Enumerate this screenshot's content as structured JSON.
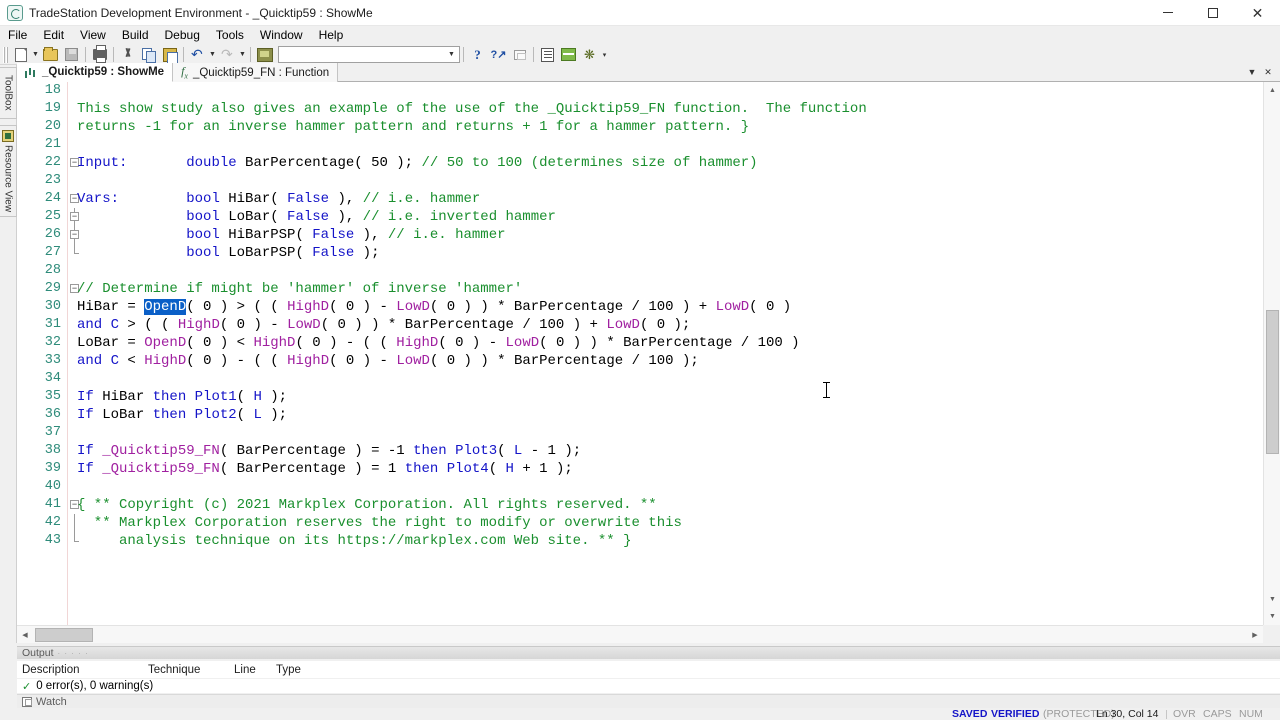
{
  "window": {
    "title": "TradeStation Development Environment - _Quicktip59 : ShowMe",
    "minimize": "–",
    "maximize": "□",
    "close": "✕"
  },
  "menu": {
    "items": [
      "File",
      "Edit",
      "View",
      "Build",
      "Debug",
      "Tools",
      "Window",
      "Help"
    ]
  },
  "toolbar": {
    "combo_value": "",
    "combo_placeholder": "",
    "buttons": [
      {
        "name": "new-document-button",
        "icon": "new-file-icon",
        "label": "New"
      },
      {
        "name": "open-file-button",
        "icon": "open-folder-icon",
        "label": "Open"
      },
      {
        "name": "save-button",
        "icon": "save-disk-icon",
        "label": "Save"
      },
      {
        "name": "print-button",
        "icon": "printer-icon",
        "label": "Print"
      },
      {
        "name": "cut-button",
        "icon": "scissors-icon",
        "label": "Cut"
      },
      {
        "name": "copy-button",
        "icon": "copy-icon",
        "label": "Copy"
      },
      {
        "name": "paste-button",
        "icon": "paste-icon",
        "label": "Paste"
      },
      {
        "name": "undo-button",
        "icon": "undo-arrow-icon",
        "label": "Undo"
      },
      {
        "name": "redo-button",
        "icon": "redo-arrow-icon",
        "label": "Redo"
      },
      {
        "name": "verify-button",
        "icon": "verify-icon",
        "label": "Verify"
      },
      {
        "name": "help-button",
        "icon": "question-mark-icon",
        "label": "Help"
      },
      {
        "name": "context-help-button",
        "icon": "help-pointer-icon",
        "label": "Context Help"
      },
      {
        "name": "bookmark-button",
        "icon": "flag-icon",
        "label": "Bookmark"
      },
      {
        "name": "properties-button",
        "icon": "book-icon",
        "label": "Properties"
      },
      {
        "name": "format-button",
        "icon": "fx-green-icon",
        "label": "Format"
      },
      {
        "name": "favorites-button",
        "icon": "star-icon",
        "label": "Favorites"
      }
    ]
  },
  "left_dock": {
    "toolbox_label": "ToolBox",
    "resource_view_label": "Resource View"
  },
  "tabs": {
    "items": [
      {
        "label": "_Quicktip59 : ShowMe",
        "icon": "showme-icon",
        "active": true
      },
      {
        "label": "_Quicktip59_FN : Function",
        "icon": "function-fx-icon",
        "active": false
      }
    ],
    "dropdown": "▼",
    "close": "✕"
  },
  "editor": {
    "selection_text": "OpenD",
    "lines": [
      {
        "n": "18",
        "fold": "",
        "tokens": []
      },
      {
        "n": "19",
        "fold": "",
        "tokens": [
          {
            "t": "This show study also gives an example of the use of the _Quicktip59_FN function.  The function",
            "c": "c-cmt"
          }
        ]
      },
      {
        "n": "20",
        "fold": "",
        "tokens": [
          {
            "t": "returns -1 for an inverse hammer pattern and returns + 1 for a hammer pattern. }",
            "c": "c-cmt"
          }
        ]
      },
      {
        "n": "21",
        "fold": "",
        "tokens": []
      },
      {
        "n": "22",
        "fold": "minus",
        "tokens": [
          {
            "t": "Input:",
            "c": "c-kw"
          },
          {
            "t": "       ",
            "c": "c-plain"
          },
          {
            "t": "double",
            "c": "c-kw"
          },
          {
            "t": " BarPercentage( 50 ); ",
            "c": "c-plain"
          },
          {
            "t": "// 50 to 100 (determines size of hammer)",
            "c": "c-cmt"
          }
        ]
      },
      {
        "n": "23",
        "fold": "",
        "tokens": []
      },
      {
        "n": "24",
        "fold": "minus",
        "tokens": [
          {
            "t": "Vars:",
            "c": "c-kw"
          },
          {
            "t": "        ",
            "c": "c-plain"
          },
          {
            "t": "bool",
            "c": "c-kw"
          },
          {
            "t": " HiBar( ",
            "c": "c-plain"
          },
          {
            "t": "False",
            "c": "c-kw"
          },
          {
            "t": " ), ",
            "c": "c-plain"
          },
          {
            "t": "// i.e. hammer",
            "c": "c-cmt"
          }
        ]
      },
      {
        "n": "25",
        "fold": "bar-minus",
        "tokens": [
          {
            "t": "             ",
            "c": "c-plain"
          },
          {
            "t": "bool",
            "c": "c-kw"
          },
          {
            "t": " LoBar( ",
            "c": "c-plain"
          },
          {
            "t": "False",
            "c": "c-kw"
          },
          {
            "t": " ), ",
            "c": "c-plain"
          },
          {
            "t": "// i.e. inverted hammer",
            "c": "c-cmt"
          }
        ]
      },
      {
        "n": "26",
        "fold": "bar-minus",
        "tokens": [
          {
            "t": "             ",
            "c": "c-plain"
          },
          {
            "t": "bool",
            "c": "c-kw"
          },
          {
            "t": " HiBarPSP( ",
            "c": "c-plain"
          },
          {
            "t": "False",
            "c": "c-kw"
          },
          {
            "t": " ), ",
            "c": "c-plain"
          },
          {
            "t": "// i.e. hammer",
            "c": "c-cmt"
          }
        ]
      },
      {
        "n": "27",
        "fold": "end",
        "tokens": [
          {
            "t": "             ",
            "c": "c-plain"
          },
          {
            "t": "bool",
            "c": "c-kw"
          },
          {
            "t": " LoBarPSP( ",
            "c": "c-plain"
          },
          {
            "t": "False",
            "c": "c-kw"
          },
          {
            "t": " );",
            "c": "c-plain"
          }
        ]
      },
      {
        "n": "28",
        "fold": "",
        "tokens": []
      },
      {
        "n": "29",
        "fold": "minus",
        "tokens": [
          {
            "t": "// Determine if might be 'hammer' of inverse 'hammer'",
            "c": "c-cmt"
          }
        ]
      },
      {
        "n": "30",
        "fold": "",
        "tokens": [
          {
            "t": "HiBar = ",
            "c": "c-plain"
          },
          {
            "t": "OpenD",
            "c": "sel"
          },
          {
            "t": "( 0 ) > ( ( ",
            "c": "c-plain"
          },
          {
            "t": "HighD",
            "c": "c-res"
          },
          {
            "t": "( 0 ) - ",
            "c": "c-plain"
          },
          {
            "t": "LowD",
            "c": "c-res"
          },
          {
            "t": "( 0 ) ) * BarPercentage / 100 ) + ",
            "c": "c-plain"
          },
          {
            "t": "LowD",
            "c": "c-res"
          },
          {
            "t": "( 0 )",
            "c": "c-plain"
          }
        ]
      },
      {
        "n": "31",
        "fold": "",
        "tokens": [
          {
            "t": "and",
            "c": "c-kw"
          },
          {
            "t": " ",
            "c": "c-plain"
          },
          {
            "t": "C",
            "c": "c-kw"
          },
          {
            "t": " > ( ( ",
            "c": "c-plain"
          },
          {
            "t": "HighD",
            "c": "c-res"
          },
          {
            "t": "( 0 ) - ",
            "c": "c-plain"
          },
          {
            "t": "LowD",
            "c": "c-res"
          },
          {
            "t": "( 0 ) ) * BarPercentage / 100 ) + ",
            "c": "c-plain"
          },
          {
            "t": "LowD",
            "c": "c-res"
          },
          {
            "t": "( 0 );",
            "c": "c-plain"
          }
        ]
      },
      {
        "n": "32",
        "fold": "",
        "tokens": [
          {
            "t": "LoBar = ",
            "c": "c-plain"
          },
          {
            "t": "OpenD",
            "c": "c-res"
          },
          {
            "t": "( 0 ) < ",
            "c": "c-plain"
          },
          {
            "t": "HighD",
            "c": "c-res"
          },
          {
            "t": "( 0 ) - ( ( ",
            "c": "c-plain"
          },
          {
            "t": "HighD",
            "c": "c-res"
          },
          {
            "t": "( 0 ) - ",
            "c": "c-plain"
          },
          {
            "t": "LowD",
            "c": "c-res"
          },
          {
            "t": "( 0 ) ) * BarPercentage / 100 )",
            "c": "c-plain"
          }
        ]
      },
      {
        "n": "33",
        "fold": "",
        "tokens": [
          {
            "t": "and",
            "c": "c-kw"
          },
          {
            "t": " ",
            "c": "c-plain"
          },
          {
            "t": "C",
            "c": "c-kw"
          },
          {
            "t": " < ",
            "c": "c-plain"
          },
          {
            "t": "HighD",
            "c": "c-res"
          },
          {
            "t": "( 0 ) - ( ( ",
            "c": "c-plain"
          },
          {
            "t": "HighD",
            "c": "c-res"
          },
          {
            "t": "( 0 ) - ",
            "c": "c-plain"
          },
          {
            "t": "LowD",
            "c": "c-res"
          },
          {
            "t": "( 0 ) ) * BarPercentage / 100 );",
            "c": "c-plain"
          }
        ]
      },
      {
        "n": "34",
        "fold": "",
        "tokens": []
      },
      {
        "n": "35",
        "fold": "",
        "tokens": [
          {
            "t": "If",
            "c": "c-kw"
          },
          {
            "t": " HiBar ",
            "c": "c-plain"
          },
          {
            "t": "then",
            "c": "c-kw"
          },
          {
            "t": " ",
            "c": "c-plain"
          },
          {
            "t": "Plot1",
            "c": "c-fn"
          },
          {
            "t": "( ",
            "c": "c-plain"
          },
          {
            "t": "H",
            "c": "c-kw"
          },
          {
            "t": " );",
            "c": "c-plain"
          }
        ]
      },
      {
        "n": "36",
        "fold": "",
        "tokens": [
          {
            "t": "If",
            "c": "c-kw"
          },
          {
            "t": " LoBar ",
            "c": "c-plain"
          },
          {
            "t": "then",
            "c": "c-kw"
          },
          {
            "t": " ",
            "c": "c-plain"
          },
          {
            "t": "Plot2",
            "c": "c-fn"
          },
          {
            "t": "( ",
            "c": "c-plain"
          },
          {
            "t": "L",
            "c": "c-kw"
          },
          {
            "t": " );",
            "c": "c-plain"
          }
        ]
      },
      {
        "n": "37",
        "fold": "",
        "tokens": []
      },
      {
        "n": "38",
        "fold": "",
        "tokens": [
          {
            "t": "If",
            "c": "c-kw"
          },
          {
            "t": " ",
            "c": "c-plain"
          },
          {
            "t": "_Quicktip59_FN",
            "c": "c-res"
          },
          {
            "t": "( BarPercentage ) = -1 ",
            "c": "c-plain"
          },
          {
            "t": "then",
            "c": "c-kw"
          },
          {
            "t": " ",
            "c": "c-plain"
          },
          {
            "t": "Plot3",
            "c": "c-fn"
          },
          {
            "t": "( ",
            "c": "c-plain"
          },
          {
            "t": "L",
            "c": "c-kw"
          },
          {
            "t": " - 1 );",
            "c": "c-plain"
          }
        ]
      },
      {
        "n": "39",
        "fold": "",
        "tokens": [
          {
            "t": "If",
            "c": "c-kw"
          },
          {
            "t": " ",
            "c": "c-plain"
          },
          {
            "t": "_Quicktip59_FN",
            "c": "c-res"
          },
          {
            "t": "( BarPercentage ) = 1 ",
            "c": "c-plain"
          },
          {
            "t": "then",
            "c": "c-kw"
          },
          {
            "t": " ",
            "c": "c-plain"
          },
          {
            "t": "Plot4",
            "c": "c-fn"
          },
          {
            "t": "( ",
            "c": "c-plain"
          },
          {
            "t": "H",
            "c": "c-kw"
          },
          {
            "t": " + 1 );",
            "c": "c-plain"
          }
        ]
      },
      {
        "n": "40",
        "fold": "",
        "tokens": []
      },
      {
        "n": "41",
        "fold": "minus",
        "tokens": [
          {
            "t": "{ ** Copyright (c) 2021 Markplex Corporation. All rights reserved. **",
            "c": "c-cmt"
          }
        ]
      },
      {
        "n": "42",
        "fold": "bar",
        "tokens": [
          {
            "t": "  ** Markplex Corporation reserves the right to modify or overwrite this",
            "c": "c-cmt"
          }
        ]
      },
      {
        "n": "43",
        "fold": "end",
        "tokens": [
          {
            "t": "     analysis technique on its https://markplex.com Web site. ** }",
            "c": "c-cmt"
          }
        ]
      }
    ]
  },
  "output": {
    "panel_title": "Output",
    "columns": [
      "Description",
      "Technique",
      "Line",
      "Type"
    ],
    "result_text": "0 error(s), 0 warning(s)",
    "watch_label": "Watch"
  },
  "status": {
    "saved": "SAVED",
    "verified": "VERIFIED",
    "protected": "(PROTECTED)",
    "position": "Ln 30, Col 14",
    "ovr": "OVR",
    "caps": "CAPS",
    "num": "NUM"
  },
  "colors": {
    "comment": "#1a8f2e",
    "keyword": "#1414c8",
    "reserved": "#a020a0",
    "linenumber": "#2e8b7a",
    "selection": "#0a5fc7",
    "status_blue": "#1414c8"
  }
}
